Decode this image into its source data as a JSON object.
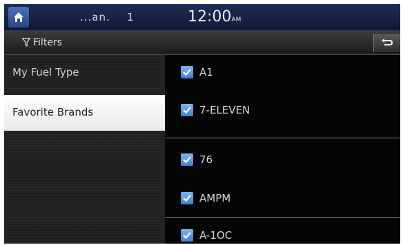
{
  "status_bar": {
    "signal_text": "...an.",
    "channel": "1",
    "clock": "12:00",
    "clock_suffix": "AM",
    "home_icon": "home-icon"
  },
  "title_bar": {
    "title": "Filters",
    "filter_icon": "filter-icon",
    "back_icon": "back-arrow-icon"
  },
  "left_menu": {
    "items": [
      {
        "label": "My Fuel Type",
        "selected": false
      },
      {
        "label": "Favorite Brands",
        "selected": true
      }
    ]
  },
  "brand_list": {
    "items": [
      {
        "label": "A1",
        "checked": true
      },
      {
        "label": "7-ELEVEN",
        "checked": true
      },
      {
        "label": "76",
        "checked": true
      },
      {
        "label": "AMPM",
        "checked": true
      },
      {
        "label": "A-1OC",
        "checked": true
      }
    ]
  },
  "colors": {
    "accent": "#3d7fd0",
    "status_bar": "#1e2d55",
    "selected_menu": "#ffffff"
  }
}
